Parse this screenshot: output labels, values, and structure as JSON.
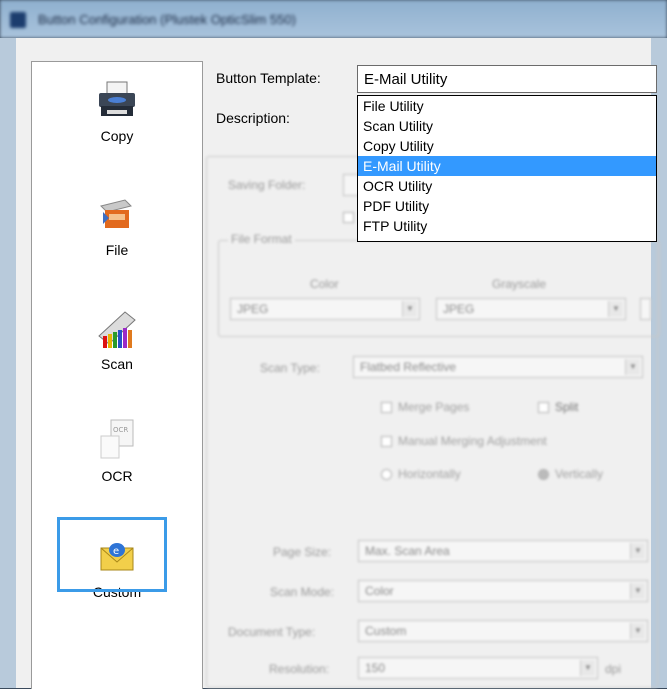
{
  "window": {
    "title": "Button Configuration (Plustek OpticSlim 550)"
  },
  "sidebar": {
    "items": [
      {
        "label": "Copy"
      },
      {
        "label": "File"
      },
      {
        "label": "Scan"
      },
      {
        "label": "OCR"
      },
      {
        "label": "Custom",
        "selected": true
      }
    ]
  },
  "form": {
    "template_label": "Button Template:",
    "template_value": "E-Mail Utility",
    "description_label": "Description:",
    "template_options": [
      "File Utility",
      "Scan Utility",
      "Copy Utility",
      "E-Mail Utility",
      "OCR Utility",
      "PDF Utility",
      "FTP Utility"
    ],
    "template_selected_index": 3
  },
  "background_form": {
    "saving_folder_label": "Saving Folder:",
    "file_format_group": "File Format",
    "color_label": "Color",
    "grayscale_label": "Grayscale",
    "color_format": "JPEG",
    "grayscale_format": "JPEG",
    "scan_type_label": "Scan Type:",
    "scan_type_value": "Flatbed Reflective",
    "merge_pages": "Merge Pages",
    "split": "Split",
    "manual_merging": "Manual Merging Adjustment",
    "horizontally": "Horizontally",
    "vertically": "Vertically",
    "page_size_label": "Page Size:",
    "page_size_value": "Max. Scan Area",
    "scan_mode_label": "Scan Mode:",
    "scan_mode_value": "Color",
    "document_type_label": "Document Type:",
    "document_type_value": "Custom",
    "resolution_label": "Resolution:",
    "resolution_value": "150",
    "resolution_unit": "dpi"
  },
  "colors": {
    "selection": "#3399ff",
    "highlight_border": "#3b9be8"
  }
}
